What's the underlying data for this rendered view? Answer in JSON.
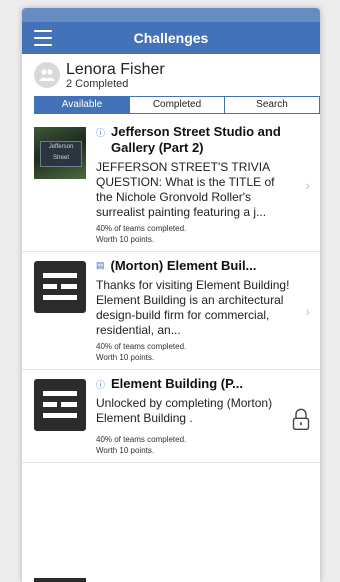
{
  "status_bar": {
    "left": "",
    "center": "",
    "right": ""
  },
  "nav": {
    "title": "Challenges"
  },
  "user": {
    "name": "Lenora Fisher",
    "completed": "2 Completed"
  },
  "tabs": [
    {
      "label": "Available",
      "active": true
    },
    {
      "label": "Completed",
      "active": false
    },
    {
      "label": "Search",
      "active": false
    }
  ],
  "items": [
    {
      "title": "Jefferson Street Studio and Gallery (Part 2)",
      "description": "JEFFERSON STREET'S TRIVIA QUESTION: What is the TITLE of the Nichole Gronvold Roller's surrealist painting featuring a j...",
      "teams": "40% of teams completed.",
      "points": "Worth 10 points.",
      "thumb_text": "Jefferson Street",
      "trailing": "chevron-right-icon"
    },
    {
      "title": "(Morton) Element Buil...",
      "description": "Thanks for visiting Element Building! Element Building is an architectural design-build firm for commercial, residential, an...",
      "teams": "40% of teams completed.",
      "points": "Worth 10 points.",
      "trailing": "chevron-right-icon"
    },
    {
      "title": "Element Building (P...",
      "description": "Unlocked by completing (Morton) Element Building .",
      "teams": "40% of teams completed.",
      "points": "Worth 10 points.",
      "trailing": "lock-icon"
    }
  ],
  "colors": {
    "brand": "#4472b8",
    "background": "#ffffff"
  }
}
